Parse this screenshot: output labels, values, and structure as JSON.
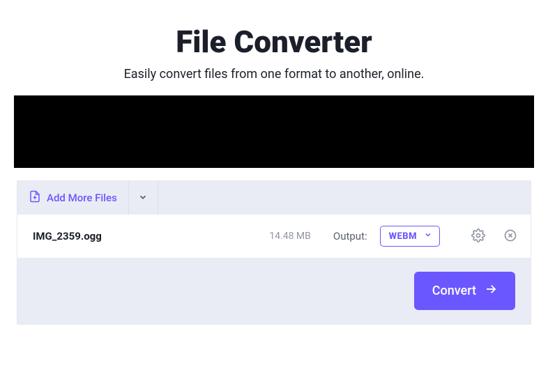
{
  "header": {
    "title": "File Converter",
    "subtitle": "Easily convert files from one format to another, online."
  },
  "toolbar": {
    "add_files_label": "Add More Files"
  },
  "file_row": {
    "name": "IMG_2359.ogg",
    "size": "14.48 MB",
    "output_label": "Output:",
    "selected_format": "WEBM"
  },
  "actions": {
    "convert_label": "Convert"
  }
}
